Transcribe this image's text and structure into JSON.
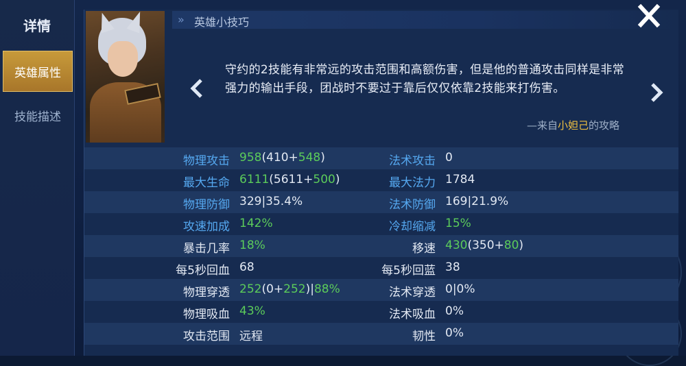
{
  "sidebar": {
    "title": "详情",
    "tabs": [
      {
        "label": "英雄属性",
        "active": true
      },
      {
        "label": "技能描述",
        "active": false
      }
    ]
  },
  "tips": {
    "header": "英雄小技巧",
    "text": "守约的2技能有非常远的攻击范围和高额伤害，但是他的普通攻击同样是非常强力的输出手段，团战时不要过于靠后仅仅依靠2技能来打伤害。",
    "source_prefix": "—来自",
    "source_author": "小妲己",
    "source_suffix": "的攻略"
  },
  "icons": {
    "close": "close-icon",
    "prev": "chevron-left-icon",
    "next": "chevron-right-icon"
  },
  "colors": {
    "label_blue": "#55a8f0",
    "bonus_green": "#5ccc5a",
    "active_tab": "#c79a3a",
    "source_author": "#f0c040"
  },
  "stats": [
    {
      "left": {
        "label": "物理攻击",
        "label_color": "blue",
        "value": [
          {
            "t": "958",
            "c": "green"
          },
          {
            "t": "(410+",
            "c": "white"
          },
          {
            "t": "548",
            "c": "green"
          },
          {
            "t": ")",
            "c": "white"
          }
        ]
      },
      "right": {
        "label": "法术攻击",
        "label_color": "blue",
        "value": [
          {
            "t": "0",
            "c": "white"
          }
        ]
      }
    },
    {
      "left": {
        "label": "最大生命",
        "label_color": "blue",
        "value": [
          {
            "t": "6111",
            "c": "green"
          },
          {
            "t": "(5611+",
            "c": "white"
          },
          {
            "t": "500",
            "c": "green"
          },
          {
            "t": ")",
            "c": "white"
          }
        ]
      },
      "right": {
        "label": "最大法力",
        "label_color": "blue",
        "value": [
          {
            "t": "1784",
            "c": "white"
          }
        ]
      }
    },
    {
      "left": {
        "label": "物理防御",
        "label_color": "blue",
        "value": [
          {
            "t": "329|35.4%",
            "c": "white"
          }
        ]
      },
      "right": {
        "label": "法术防御",
        "label_color": "blue",
        "value": [
          {
            "t": "169|21.9%",
            "c": "white"
          }
        ]
      }
    },
    {
      "left": {
        "label": "攻速加成",
        "label_color": "blue",
        "value": [
          {
            "t": "142%",
            "c": "green"
          }
        ]
      },
      "right": {
        "label": "冷却缩减",
        "label_color": "blue",
        "value": [
          {
            "t": "15%",
            "c": "green"
          }
        ]
      }
    },
    {
      "left": {
        "label": "暴击几率",
        "label_color": "white",
        "value": [
          {
            "t": "18%",
            "c": "green"
          }
        ]
      },
      "right": {
        "label": "移速",
        "label_color": "white",
        "value": [
          {
            "t": "430",
            "c": "green"
          },
          {
            "t": "(350+",
            "c": "white"
          },
          {
            "t": "80",
            "c": "green"
          },
          {
            "t": ")",
            "c": "white"
          }
        ]
      }
    },
    {
      "left": {
        "label": "每5秒回血",
        "label_color": "white",
        "value": [
          {
            "t": "68",
            "c": "white"
          }
        ]
      },
      "right": {
        "label": "每5秒回蓝",
        "label_color": "white",
        "value": [
          {
            "t": "38",
            "c": "white"
          }
        ]
      }
    },
    {
      "left": {
        "label": "物理穿透",
        "label_color": "white",
        "value": [
          {
            "t": "252",
            "c": "green"
          },
          {
            "t": "(0+",
            "c": "white"
          },
          {
            "t": "252",
            "c": "green"
          },
          {
            "t": ")|",
            "c": "white"
          },
          {
            "t": "88%",
            "c": "green"
          }
        ]
      },
      "right": {
        "label": "法术穿透",
        "label_color": "white",
        "value": [
          {
            "t": "0|0%",
            "c": "white"
          }
        ]
      }
    },
    {
      "left": {
        "label": "物理吸血",
        "label_color": "white",
        "value": [
          {
            "t": "43%",
            "c": "green"
          }
        ]
      },
      "right": {
        "label": "法术吸血",
        "label_color": "white",
        "value": [
          {
            "t": "0%",
            "c": "white"
          }
        ]
      }
    },
    {
      "left": {
        "label": "攻击范围",
        "label_color": "white",
        "value": [
          {
            "t": "远程",
            "c": "white"
          }
        ]
      },
      "right": {
        "label": "韧性",
        "label_color": "white",
        "value": [
          {
            "t": "0%",
            "c": "white"
          }
        ]
      }
    }
  ]
}
